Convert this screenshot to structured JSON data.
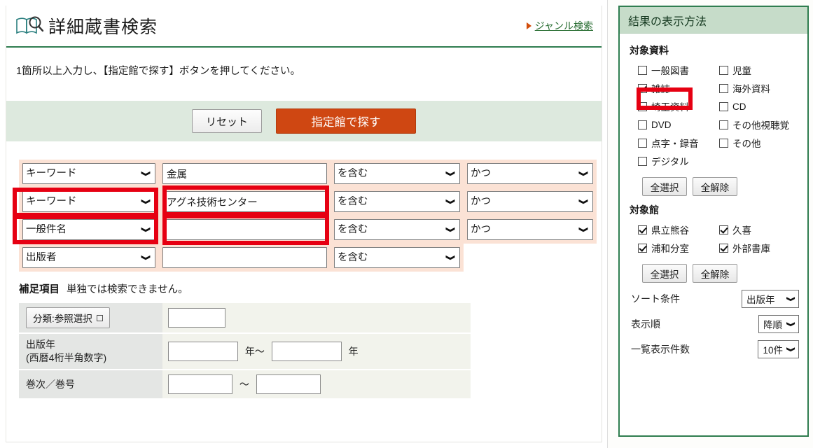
{
  "header": {
    "title": "詳細蔵書検索",
    "icon": "book-search-icon",
    "genre_link": "ジャンル検索",
    "bullet_icon": "triangle-bullet-icon"
  },
  "instruction": "1箇所以上入力し、【指定館で探す】ボタンを押してください。",
  "buttons": {
    "reset": "リセット",
    "search": "指定館で探す"
  },
  "search_rows": [
    {
      "field": "キーワード",
      "value": "金属",
      "placeholder": "",
      "operator": "を含む",
      "boolean": "かつ",
      "has_boolean": true,
      "highlight_field": true,
      "highlight_value": true
    },
    {
      "field": "キーワード",
      "value": "アグネ技術センター",
      "placeholder": "",
      "operator": "を含む",
      "boolean": "かつ",
      "has_boolean": true,
      "highlight_field": true,
      "highlight_value": true
    },
    {
      "field": "一般件名",
      "value": "",
      "placeholder": "",
      "operator": "を含む",
      "boolean": "かつ",
      "has_boolean": true,
      "highlight_field": false,
      "highlight_value": false
    },
    {
      "field": "出版者",
      "value": "",
      "placeholder": "",
      "operator": "を含む",
      "boolean": "",
      "has_boolean": false,
      "highlight_field": false,
      "highlight_value": false
    }
  ],
  "supplementary": {
    "heading": "補足項目",
    "note": "単独では検索できません。",
    "rows": {
      "classification_button": "分類:参照選択",
      "classification_value": "",
      "pubyear_label_line1": "出版年",
      "pubyear_label_line2": "(西暦4桁半角数字)",
      "pubyear_from": "",
      "pubyear_to": "",
      "year_unit_from": "年～",
      "year_unit_to": "年",
      "volume_label": "巻次／巻号",
      "volume_from": "",
      "volume_to": "",
      "volume_sep": "～"
    }
  },
  "right_panel": {
    "title": "結果の表示方法",
    "materials": {
      "group_title": "対象資料",
      "items": [
        {
          "label": "一般図書",
          "checked": false,
          "highlight": false
        },
        {
          "label": "児童",
          "checked": false,
          "highlight": false
        },
        {
          "label": "雑誌",
          "checked": true,
          "highlight": true
        },
        {
          "label": "海外資料",
          "checked": false,
          "highlight": false
        },
        {
          "label": "埼玉資料",
          "checked": false,
          "highlight": false
        },
        {
          "label": "CD",
          "checked": false,
          "highlight": false
        },
        {
          "label": "DVD",
          "checked": false,
          "highlight": false
        },
        {
          "label": "その他視聴覚",
          "checked": false,
          "highlight": false
        },
        {
          "label": "点字・録音",
          "checked": false,
          "highlight": false
        },
        {
          "label": "その他",
          "checked": false,
          "highlight": false
        },
        {
          "label": "デジタル",
          "checked": false,
          "highlight": false
        }
      ],
      "select_all": "全選択",
      "clear_all": "全解除"
    },
    "libraries": {
      "group_title": "対象館",
      "items": [
        {
          "label": "県立熊谷",
          "checked": true
        },
        {
          "label": "久喜",
          "checked": true
        },
        {
          "label": "浦和分室",
          "checked": true
        },
        {
          "label": "外部書庫",
          "checked": true
        }
      ],
      "select_all": "全選択",
      "clear_all": "全解除"
    },
    "options": [
      {
        "label": "ソート条件",
        "value": "出版年",
        "name": "sort-condition"
      },
      {
        "label": "表示順",
        "value": "降順",
        "name": "sort-order"
      },
      {
        "label": "一覧表示件数",
        "value": "10件",
        "name": "results-per-page"
      }
    ]
  },
  "colors": {
    "accent_green": "#2f7d4f",
    "search_button_orange": "#cf4712",
    "highlight_red": "#e60012",
    "row_peach": "#fbe2d5",
    "band_green": "#dde9de",
    "panel_header_green": "#c6dcc9"
  }
}
